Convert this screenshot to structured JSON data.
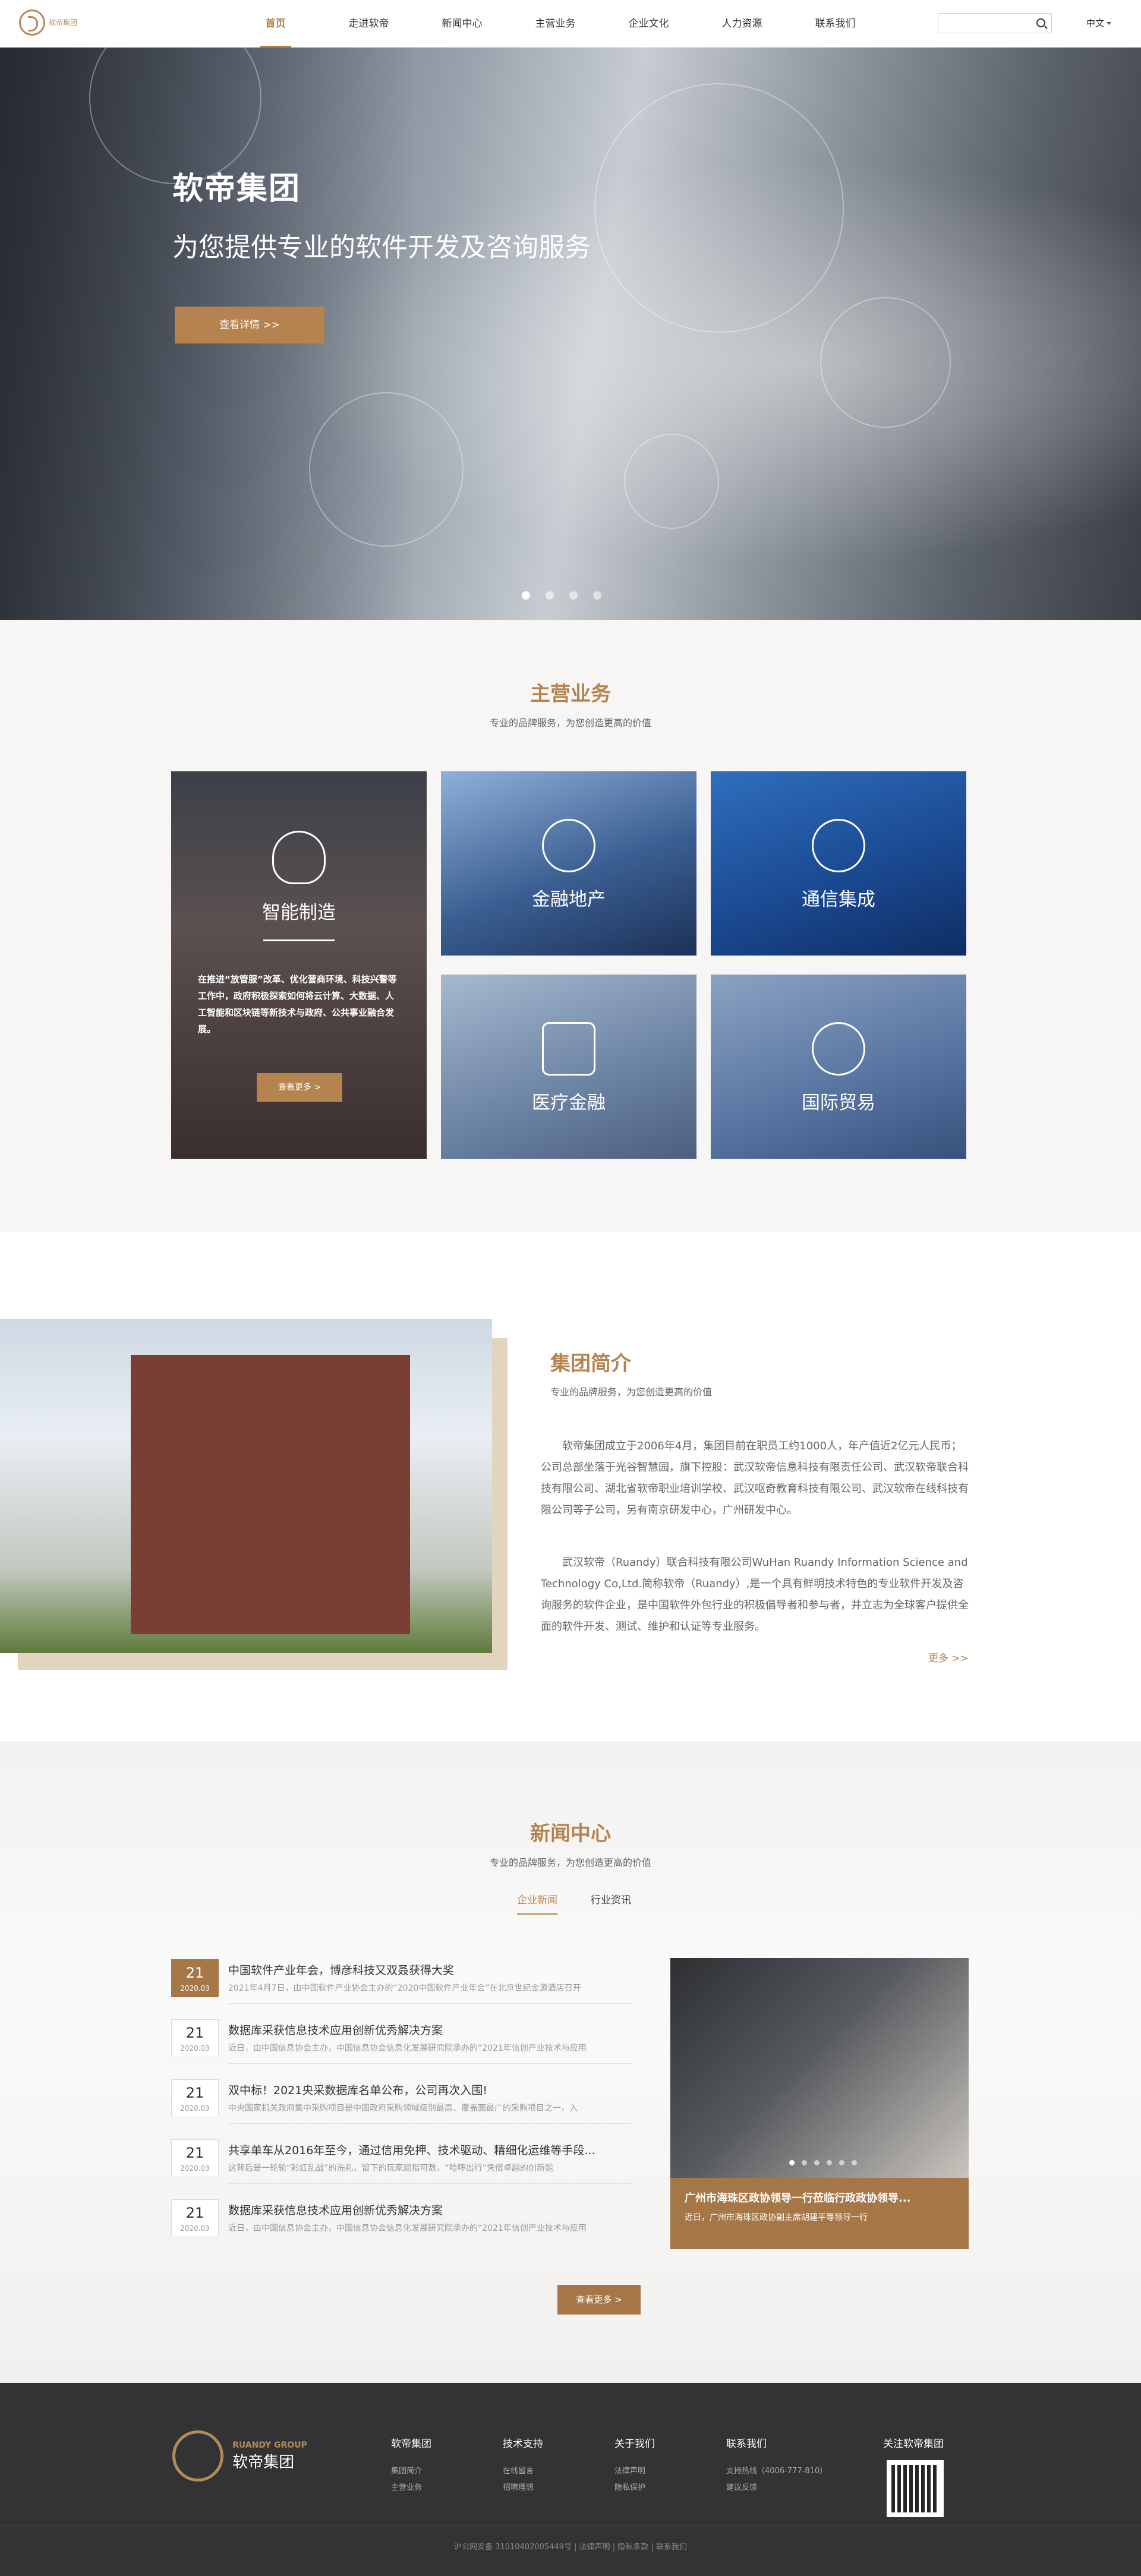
{
  "header": {
    "logo_cn": "软帝集团",
    "nav": [
      "首页",
      "走进软帝",
      "新闻中心",
      "主营业务",
      "企业文化",
      "人力资源",
      "联系我们"
    ],
    "search_placeholder": "",
    "lang": "中文"
  },
  "hero": {
    "title": "软帝集团",
    "subtitle": "为您提供专业的软件开发及咨询服务",
    "button": "查看详情 >>",
    "slides": 4,
    "active_slide": 0
  },
  "business": {
    "title": "主营业务",
    "subtitle": "专业的品牌服务，为您创造更高的价值",
    "cards": [
      {
        "label": "智能制造",
        "desc": "在推进“放管服”改革、优化营商环境、科技兴警等工作中，政府积极探索如何将云计算、大数据、人工智能和区块链等新技术与政府、公共事业融合发展。",
        "button": "查看更多 >"
      },
      {
        "label": "金融地产"
      },
      {
        "label": "通信集成"
      },
      {
        "label": "医疗金融"
      },
      {
        "label": "国际贸易"
      }
    ]
  },
  "about": {
    "title": "集团简介",
    "subtitle": "专业的品牌服务，为您创造更高的价值",
    "p1": "软帝集团成立于2006年4月，集团目前在职员工约1000人，年产值近2亿元人民币；公司总部坐落于光谷智慧园，旗下控股：武汉软帝信息科技有限责任公司、武汉软帝联合科技有限公司、湖北省软帝职业培训学校、武汉呕奇教育科技有限公司、武汉软帝在线科技有限公司等子公司，另有南京研发中心，广州研发中心。",
    "p2": "武汉软帝（Ruandy）联合科技有限公司WuHan Ruandy Information Science and Technology Co,Ltd.简称软帝（Ruandy）,是一个具有鲜明技术特色的专业软件开发及咨询服务的软件企业，是中国软件外包行业的积极倡导者和参与者，并立志为全球客户提供全面的软件开发、测试、维护和认证等专业服务。",
    "more": "更多 >>"
  },
  "news": {
    "title": "新闻中心",
    "subtitle": "专业的品牌服务，为您创造更高的价值",
    "tabs": [
      "企业新闻",
      "行业资讯"
    ],
    "items": [
      {
        "day": "21",
        "ym": "2020.03",
        "title": "中国软件产业年会，博彦科技又双叒获得大奖",
        "brief": "2021年4月7日，由中国软件产业协会主办的“2020中国软件产业年会”在北京世纪金源酒店召开"
      },
      {
        "day": "21",
        "ym": "2020.03",
        "title": "数据库采获信息技术应用创新优秀解决方案",
        "brief": "近日，由中国信息协会主办，中国信息协会信息化发展研究院承办的“2021年信创产业技术与应用"
      },
      {
        "day": "21",
        "ym": "2020.03",
        "title": "双中标！2021央采数据库名单公布，公司再次入围!",
        "brief": "中央国家机关政府集中采购项目是中国政府采购领域级别最高、覆盖面最广的采购项目之一，入"
      },
      {
        "day": "21",
        "ym": "2020.03",
        "title": "共享单车从2016年至今，通过信用免押、技术驱动、精细化运维等手段...",
        "brief": "这背后是一轮轮“彩虹乱战”的洗礼，留下的玩家屈指可数，“哈啰出行”凭借卓越的创新能"
      },
      {
        "day": "21",
        "ym": "2020.03",
        "title": "数据库采获信息技术应用创新优秀解决方案",
        "brief": "近日，由中国信息协会主办，中国信息协会信息化发展研究院承办的“2021年信创产业技术与应用"
      }
    ],
    "feature": {
      "title": "广州市海珠区政协领导一行莅临行政政协领导...",
      "sub": "近日，广州市海珠区政协副主席胡建平等领导一行"
    },
    "more": "查看更多 >"
  },
  "footer": {
    "logo_en": "RUANDY GROUP",
    "logo_cn": "软帝集团",
    "cols": [
      {
        "h": "软帝集团",
        "links": [
          "集团简介",
          "主营业务"
        ]
      },
      {
        "h": "技术支持",
        "links": [
          "在线留言",
          "招聘理想"
        ]
      },
      {
        "h": "关于我们",
        "links": [
          "法律声明",
          "隐私保护"
        ]
      },
      {
        "h": "联系我们",
        "links": [
          "支持热线（4006-777-810）",
          "建议反馈"
        ]
      },
      {
        "h": "关注软帝集团",
        "links": []
      }
    ],
    "copyright": "沪公网安备 31010402005449号  |  法律声明  |  隐私条款  |  联系我们"
  },
  "colors": {
    "accent": "#b5834d",
    "footer": "#333336"
  }
}
